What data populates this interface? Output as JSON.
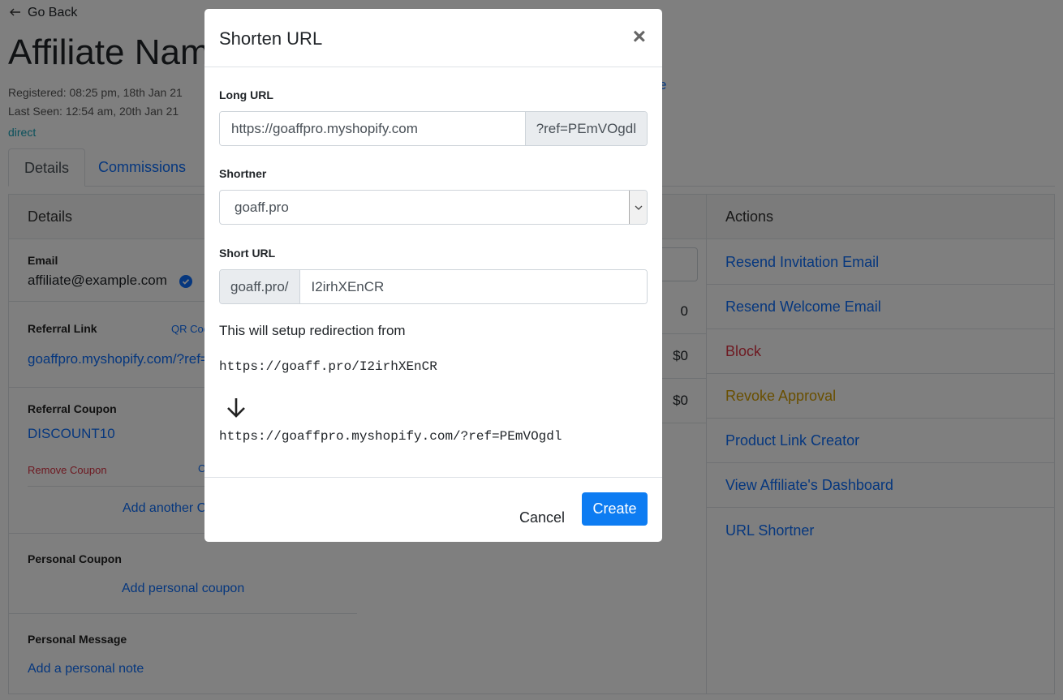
{
  "page": {
    "go_back": "Go Back",
    "title": "Affiliate Name",
    "registered": "Registered: 08:25 pm, 18th Jan 21",
    "last_seen": "Last Seen: 12:54 am, 20th Jan 21",
    "source": "direct",
    "partial_link": "e",
    "tabs": [
      "Details",
      "Commissions"
    ]
  },
  "details_card": {
    "header": "Details",
    "email_label": "Email",
    "email": "affiliate@example.com",
    "referral_link_label": "Referral Link",
    "qr_code": "QR Code",
    "referral_link": "goaffpro.myshopify.com/?ref=PEmVOgdl",
    "referral_coupon_label": "Referral Coupon",
    "coupon": "DISCOUNT10",
    "remove_coupon": "Remove Coupon",
    "copy": "C",
    "add_another": "Add another Coupon",
    "personal_coupon_label": "Personal Coupon",
    "add_personal_coupon": "Add personal coupon",
    "personal_message_label": "Personal Message",
    "add_personal_note": "Add a personal note"
  },
  "stats_card": {
    "values": [
      "0",
      "$0",
      "$0"
    ]
  },
  "actions_card": {
    "header": "Actions",
    "items": [
      "Resend Invitation Email",
      "Resend Welcome Email",
      "Block",
      "Revoke Approval",
      "Product Link Creator",
      "View Affiliate's Dashboard",
      "URL Shortner"
    ]
  },
  "modal": {
    "title": "Shorten URL",
    "close": "×",
    "long_url_label": "Long URL",
    "long_url_value": "https://goaffpro.myshopify.com",
    "long_url_suffix": "?ref=PEmVOgdl",
    "shortner_label": "Shortner",
    "shortner_value": "goaff.pro",
    "short_url_label": "Short URL",
    "short_url_prefix": "goaff.pro/",
    "short_url_value": "I2irhXEnCR",
    "redirect_text": "This will setup redirection from",
    "from_url": "https://goaff.pro/I2irhXEnCR",
    "to_url": "https://goaffpro.myshopify.com/?ref=PEmVOgdl",
    "cancel": "Cancel",
    "create": "Create"
  },
  "colors": {
    "accent": "#0d7cf2",
    "danger": "#dc3545",
    "warning": "#d39e00",
    "link": "#0d6efd"
  }
}
